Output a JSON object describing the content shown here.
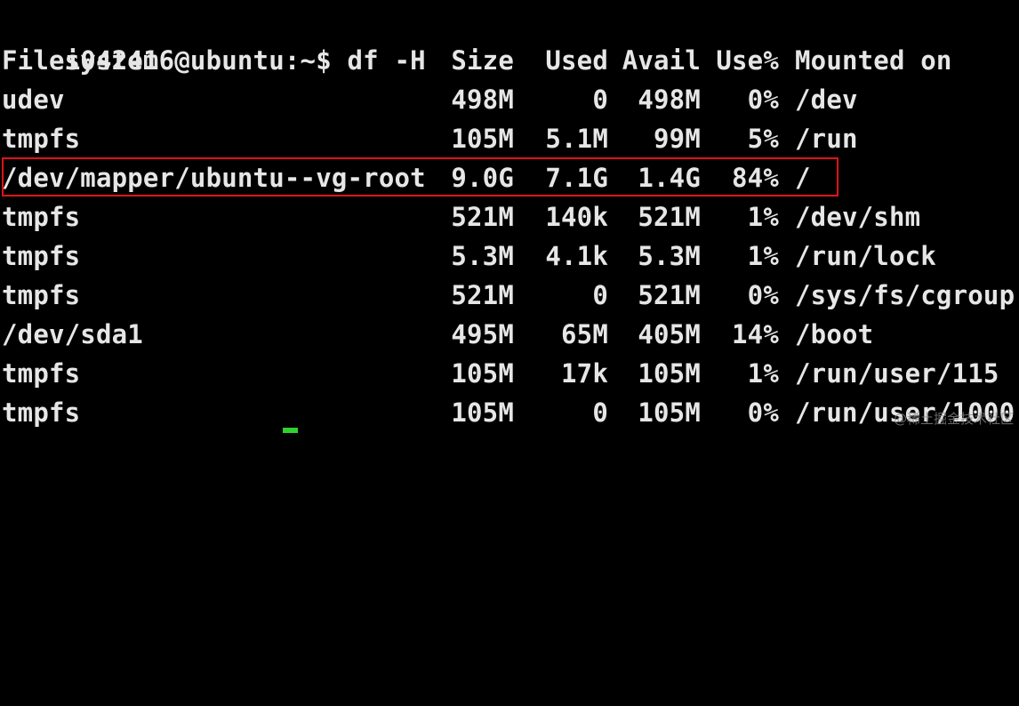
{
  "prompt": "i042416@ubuntu:~$ df -H",
  "header": {
    "filesystem": "Filesystem",
    "size": "Size",
    "used": "Used",
    "avail": "Avail",
    "use_pct": "Use%",
    "mounted": "Mounted on"
  },
  "rows": [
    {
      "filesystem": "udev",
      "size": "498M",
      "used": "0",
      "avail": "498M",
      "use_pct": "0%",
      "mounted": "/dev"
    },
    {
      "filesystem": "tmpfs",
      "size": "105M",
      "used": "5.1M",
      "avail": "99M",
      "use_pct": "5%",
      "mounted": "/run"
    },
    {
      "filesystem": "/dev/mapper/ubuntu--vg-root",
      "size": "9.0G",
      "used": "7.1G",
      "avail": "1.4G",
      "use_pct": "84%",
      "mounted": "/"
    },
    {
      "filesystem": "tmpfs",
      "size": "521M",
      "used": "140k",
      "avail": "521M",
      "use_pct": "1%",
      "mounted": "/dev/shm"
    },
    {
      "filesystem": "tmpfs",
      "size": "5.3M",
      "used": "4.1k",
      "avail": "5.3M",
      "use_pct": "1%",
      "mounted": "/run/lock"
    },
    {
      "filesystem": "tmpfs",
      "size": "521M",
      "used": "0",
      "avail": "521M",
      "use_pct": "0%",
      "mounted": "/sys/fs/cgroup"
    },
    {
      "filesystem": "/dev/sda1",
      "size": "495M",
      "used": "65M",
      "avail": "405M",
      "use_pct": "14%",
      "mounted": "/boot"
    },
    {
      "filesystem": "tmpfs",
      "size": "105M",
      "used": "17k",
      "avail": "105M",
      "use_pct": "1%",
      "mounted": "/run/user/115"
    },
    {
      "filesystem": "tmpfs",
      "size": "105M",
      "used": "0",
      "avail": "105M",
      "use_pct": "0%",
      "mounted": "/run/user/1000"
    }
  ],
  "watermark": "@稀土掘金技术社区",
  "colors": {
    "background": "#000000",
    "text": "#e6e6e6",
    "highlight_border": "#e0121b",
    "cursor": "#2fd12f"
  }
}
